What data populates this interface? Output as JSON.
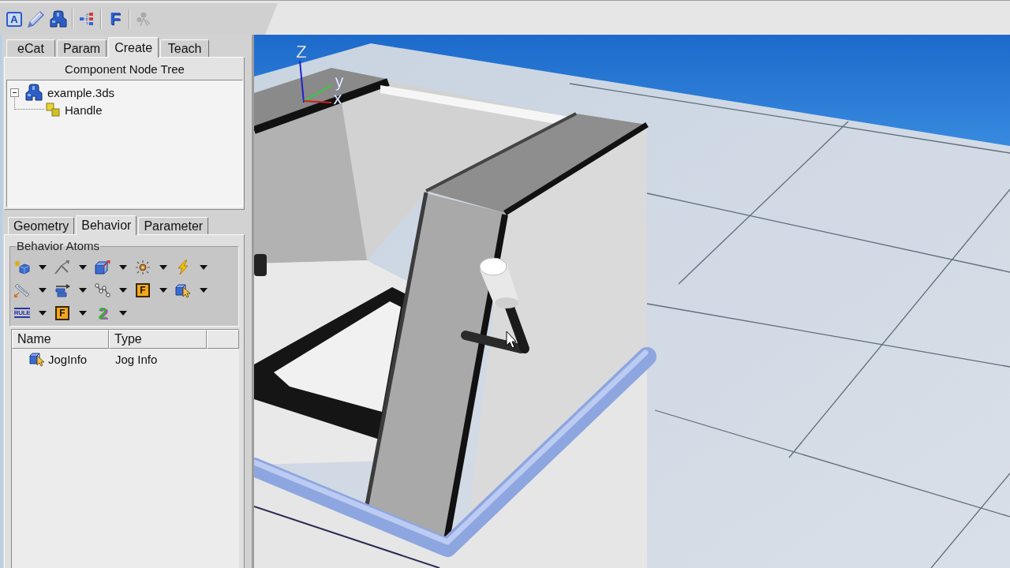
{
  "toolbar": {
    "groups": [
      [
        {
          "kind": "boxed-glyph",
          "glyph": "A",
          "disabled": false
        },
        {
          "kind": "pencil",
          "disabled": false
        },
        {
          "kind": "component",
          "disabled": false
        }
      ],
      [
        {
          "kind": "tree",
          "disabled": false
        }
      ],
      [
        {
          "kind": "glyph",
          "glyph": "F",
          "disabled": false
        }
      ],
      [
        {
          "kind": "people",
          "disabled": true
        }
      ]
    ]
  },
  "main_tabs": [
    {
      "label": "eCat",
      "selected": false
    },
    {
      "label": "Param",
      "selected": false
    },
    {
      "label": "Create",
      "selected": true
    },
    {
      "label": "Teach",
      "selected": false
    }
  ],
  "node_tree": {
    "title": "Component Node Tree",
    "nodes": [
      {
        "label": "example.3ds",
        "kind": "component",
        "expanded": true,
        "children": [
          {
            "label": "Handle",
            "kind": "link"
          }
        ]
      }
    ]
  },
  "sub_tabs": [
    {
      "label": "Geometry",
      "selected": false
    },
    {
      "label": "Behavior",
      "selected": true
    },
    {
      "label": "Parameter",
      "selected": false
    }
  ],
  "behavior_atoms": {
    "title": "Behavior Atoms",
    "rows": [
      [
        {
          "kind": "sparkle-cube"
        },
        {
          "kind": "angle-arrow"
        },
        {
          "kind": "box-arrow"
        },
        {
          "kind": "gear-arrows"
        },
        {
          "kind": "lightning"
        }
      ],
      [
        {
          "kind": "ruler"
        },
        {
          "kind": "stack-arrow"
        },
        {
          "kind": "path-nodes"
        },
        {
          "kind": "badge-glyph",
          "glyph": "F"
        },
        {
          "kind": "cube-cursor"
        }
      ],
      [
        {
          "kind": "label-glyph",
          "glyph": "RULE"
        },
        {
          "kind": "badge-glyph",
          "glyph": "F"
        },
        {
          "kind": "figure-glyph",
          "glyph": "2"
        }
      ]
    ]
  },
  "behavior_list": {
    "columns": [
      "Name",
      "Type"
    ],
    "rows": [
      {
        "kind": "cube-cursor",
        "name": "JogInfo",
        "type": "Jog Info"
      }
    ]
  },
  "viewport": {
    "axis_labels": [
      "Z",
      "y",
      "x"
    ]
  }
}
